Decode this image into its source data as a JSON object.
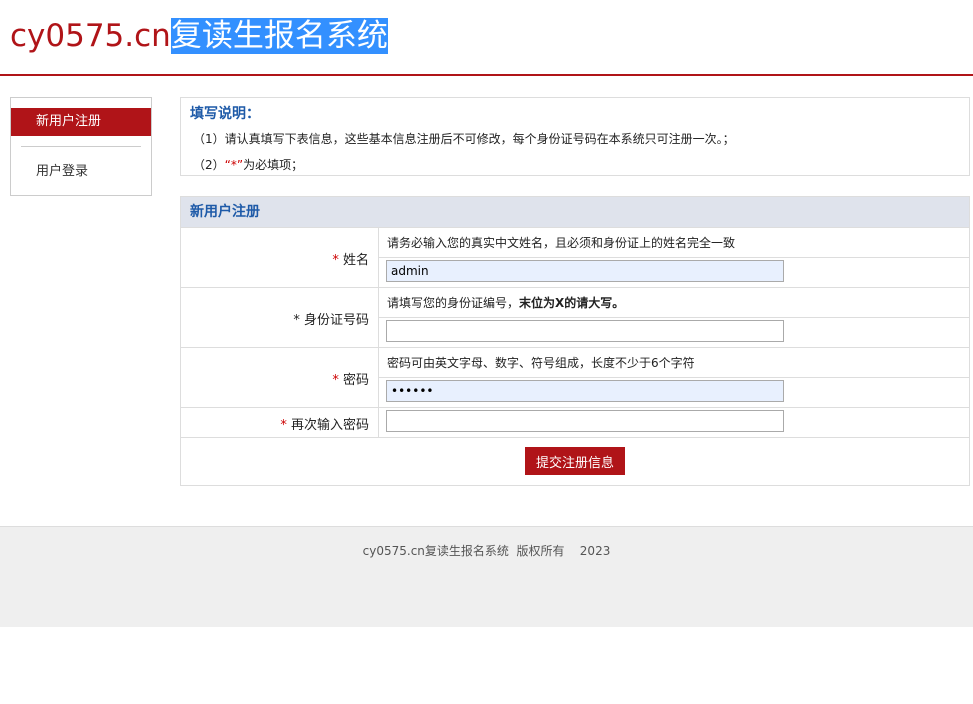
{
  "header": {
    "logo_domain": "cy0575.cn",
    "logo_title": "复读生报名系统"
  },
  "sidebar": {
    "items": [
      {
        "label": "新用户注册",
        "active": true
      },
      {
        "label": "用户登录",
        "active": false
      }
    ]
  },
  "notes": {
    "title": "填写说明：",
    "line1": "（1）请认真填写下表信息，这些基本信息注册后不可修改，每个身份证号码在本系统只可注册一次。；",
    "line2_prefix": "（2）",
    "line2_mark": "“*”",
    "line2_suffix": "为必填项；"
  },
  "form": {
    "title": "新用户注册",
    "required_mark": "*",
    "name": {
      "label": "姓名",
      "hint": "请务必输入您的真实中文姓名，且必须和身份证上的姓名完全一致",
      "value": "admin"
    },
    "id_number": {
      "label": "身份证号码",
      "hint_prefix": "请填写您的身份证编号，",
      "hint_bold": "末位为X的请大写。",
      "value": ""
    },
    "password": {
      "label": "密码",
      "hint": "密码可由英文字母、数字、符号组成，长度不少于6个字符",
      "value": "••••••"
    },
    "confirm_password": {
      "label": "再次输入密码",
      "value": ""
    },
    "submit_label": "提交注册信息"
  },
  "footer": {
    "text": "cy0575.cn复读生报名系统  版权所有    2023"
  },
  "colors": {
    "brand_red": "#b01418",
    "title_blue": "#1e5aa8",
    "selection_blue": "#3390ff"
  }
}
